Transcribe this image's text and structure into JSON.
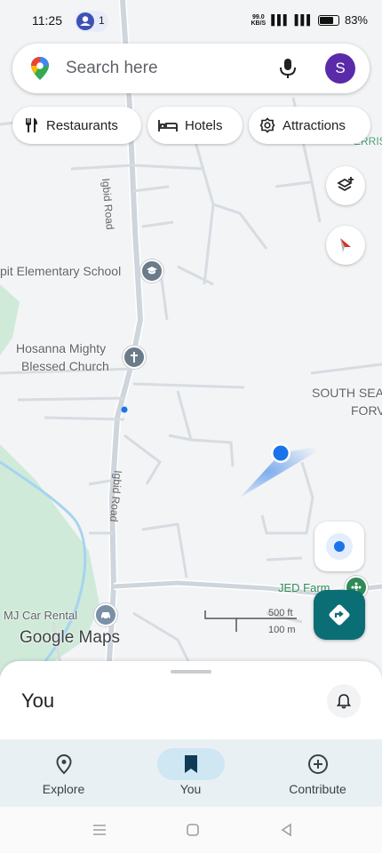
{
  "status_bar": {
    "time": "11:25",
    "people_count": "1",
    "network_speed_top": "99.0",
    "network_speed_unit": "KB/S",
    "battery": "83%"
  },
  "search": {
    "placeholder": "Search here",
    "avatar_letter": "S"
  },
  "chips": [
    {
      "label": "Restaurants",
      "icon": "fork-knife-icon"
    },
    {
      "label": "Hotels",
      "icon": "bed-icon"
    },
    {
      "label": "Attractions",
      "icon": "camera-icon"
    }
  ],
  "map": {
    "labels": {
      "school": "pit Elementary School",
      "church_line1": "Hosanna Mighty",
      "church_line2": "Blessed Church",
      "south_sea_line1": "SOUTH SEA",
      "south_sea_line2": "FORV",
      "road_top": "Igbid Road",
      "road_bottom": "Igbid Road",
      "jed_farm": "JED Farm",
      "mj_car_rental": "MJ Car Rental",
      "corner_top_right": "ERRISO"
    },
    "attribution": "Google Maps",
    "scale": {
      "feet": "500 ft",
      "meters": "100 m"
    }
  },
  "bottom_sheet": {
    "title": "You"
  },
  "bottom_nav": [
    {
      "label": "Explore",
      "icon": "location-pin-icon",
      "active": false
    },
    {
      "label": "You",
      "icon": "bookmark-icon",
      "active": true
    },
    {
      "label": "Contribute",
      "icon": "add-circle-icon",
      "active": false
    }
  ],
  "colors": {
    "accent": "#0b6e75",
    "avatar": "#5b2aa8",
    "location_dot": "#1a73e8",
    "nav_active_bg": "#cfe7f2"
  }
}
